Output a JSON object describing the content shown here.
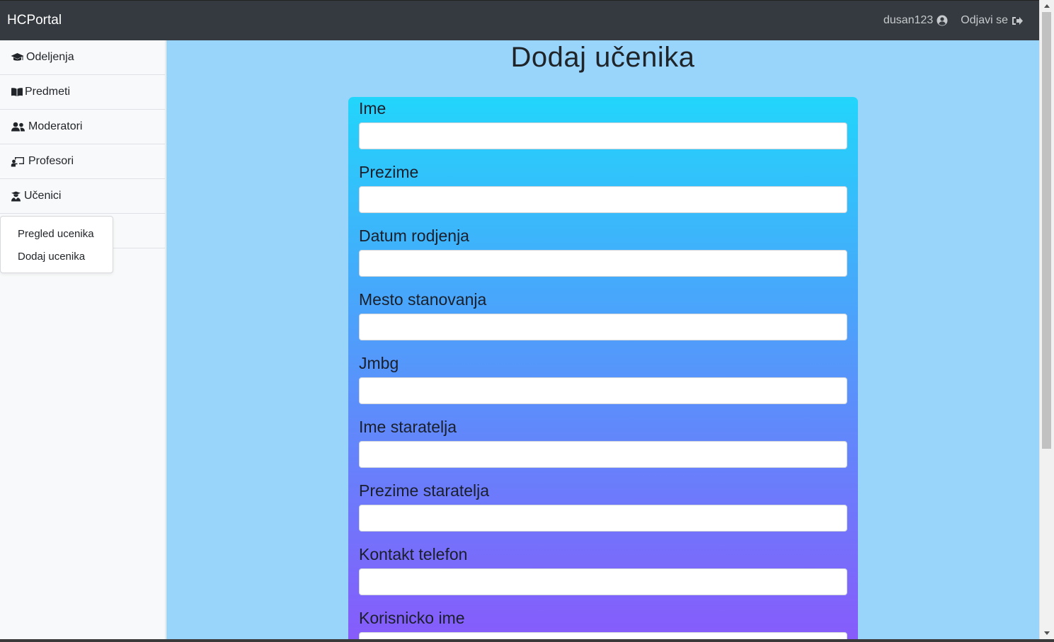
{
  "navbar": {
    "brand": "HCPortal",
    "username": "dusan123",
    "logout_label": "Odjavi se",
    "user_icon": "user-circle-icon",
    "logout_icon": "sign-out-icon"
  },
  "sidebar": {
    "items": [
      {
        "label": "Odeljenja",
        "icon": "graduation-cap-icon"
      },
      {
        "label": "Predmeti",
        "icon": "book-open-icon"
      },
      {
        "label": "Moderatori",
        "icon": "users-icon"
      },
      {
        "label": "Profesori",
        "icon": "chalkboard-teacher-icon"
      },
      {
        "label": "Učenici",
        "icon": "user-graduate-icon"
      }
    ],
    "dropdown": [
      "Pregled ucenika",
      "Dodaj ucenika"
    ]
  },
  "main": {
    "title": "Dodaj učenika",
    "fields": [
      {
        "label": "Ime",
        "value": ""
      },
      {
        "label": "Prezime",
        "value": ""
      },
      {
        "label": "Datum rodjenja",
        "value": ""
      },
      {
        "label": "Mesto stanovanja",
        "value": ""
      },
      {
        "label": "Jmbg",
        "value": ""
      },
      {
        "label": "Ime staratelja",
        "value": ""
      },
      {
        "label": "Prezime staratelja",
        "value": ""
      },
      {
        "label": "Kontakt telefon",
        "value": ""
      },
      {
        "label": "Korisnicko ime",
        "value": ""
      }
    ]
  },
  "colors": {
    "navbar": "#343a40",
    "main_bg": "#99d4fb",
    "card_gradient_top": "#22d5fb",
    "card_gradient_bottom": "#8b56fb"
  }
}
